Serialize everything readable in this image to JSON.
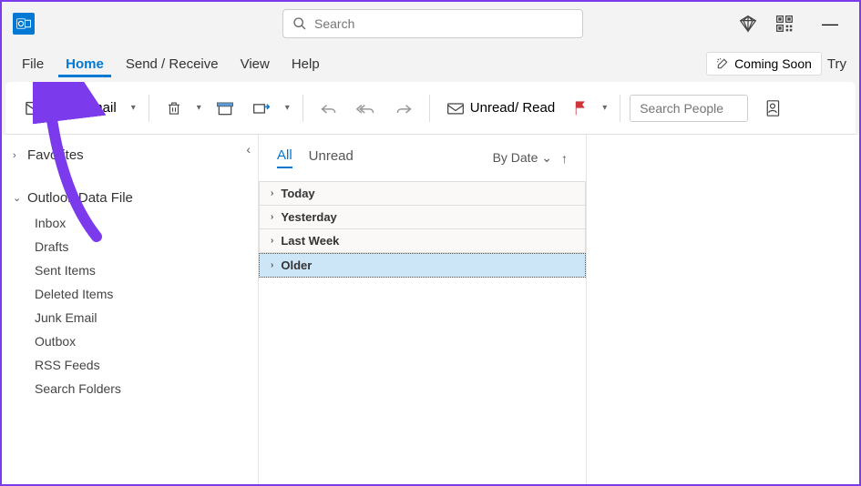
{
  "titlebar": {
    "search_placeholder": "Search"
  },
  "menubar": {
    "tabs": [
      "File",
      "Home",
      "Send / Receive",
      "View",
      "Help"
    ],
    "active_index": 1,
    "coming_soon": "Coming Soon",
    "try": "Try"
  },
  "ribbon": {
    "new_email": "New Email",
    "unread_read": "Unread/ Read",
    "search_people_placeholder": "Search People"
  },
  "sidebar": {
    "favorites": "Favorites",
    "data_file": "Outlook Data File",
    "folders": [
      "Inbox",
      "Drafts",
      "Sent Items",
      "Deleted Items",
      "Junk Email",
      "Outbox",
      "RSS Feeds",
      "Search Folders"
    ]
  },
  "msglist": {
    "filters": [
      "All",
      "Unread"
    ],
    "active_filter": 0,
    "sort_label": "By Date",
    "groups": [
      "Today",
      "Yesterday",
      "Last Week",
      "Older"
    ],
    "selected_group": 3
  }
}
